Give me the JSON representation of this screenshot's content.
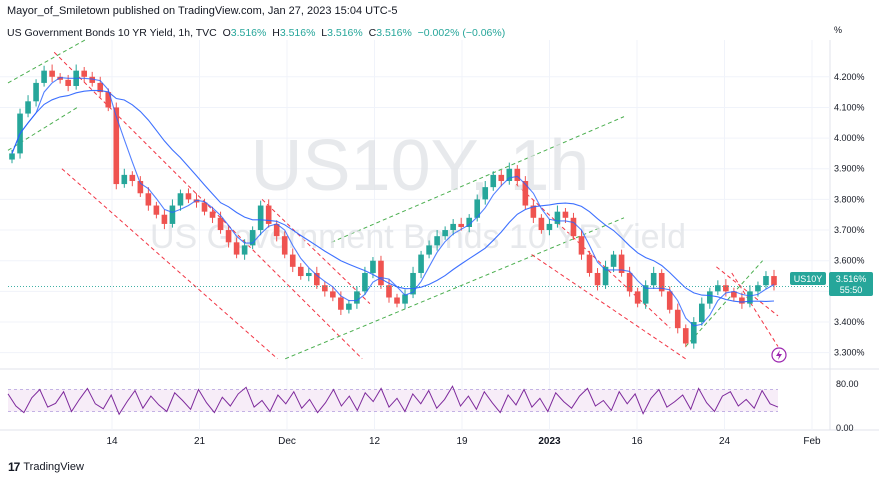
{
  "header": {
    "published": "Mayor_of_Smiletown published on TradingView.com, Jan 27, 2023 15:04 UTC-5",
    "symbol": "US Government Bonds 10 YR Yield, 1h, TVC",
    "o_label": "O",
    "o_val": "3.516%",
    "h_label": "H",
    "h_val": "3.516%",
    "l_label": "L",
    "l_val": "3.516%",
    "c_label": "C",
    "c_val": "3.516%",
    "change": "−0.002% (−0.06%)"
  },
  "watermark": {
    "big": "US10Y, 1h",
    "sub": "US Government Bonds 10 YR Yield"
  },
  "price_badge": {
    "symbol": "US10Y",
    "price": "3.516%",
    "countdown": "55:50"
  },
  "footer": {
    "brand": "TradingView",
    "logo": "17"
  },
  "colors": {
    "up": "#26a69a",
    "down": "#ef5350",
    "ma": "#2962ff",
    "rsi": "#7e2a9c",
    "green_channel": "#4caf50",
    "red_channel": "#f23645",
    "badge": "#26a69a",
    "axis_text": "#131722"
  },
  "chart_data": [
    {
      "type": "line",
      "title": "",
      "y_unit": "%",
      "y_ticks": [
        "4.200%",
        "4.100%",
        "4.000%",
        "3.900%",
        "3.800%",
        "3.700%",
        "3.600%",
        "3.500%",
        "3.400%",
        "3.300%"
      ],
      "ylim": [
        3.25,
        4.32
      ],
      "x_ticks": [
        "14",
        "21",
        "Dec",
        "12",
        "19",
        "2023",
        "16",
        "24",
        "Feb"
      ],
      "series": [
        {
          "values": [
            3.95,
            4.08,
            4.12,
            4.18,
            4.22,
            4.2,
            4.19,
            4.17,
            4.22,
            4.2,
            4.18,
            4.15,
            4.1,
            3.85,
            3.88,
            3.86,
            3.82,
            3.78,
            3.75,
            3.72,
            3.78,
            3.82,
            3.8,
            3.79,
            3.76,
            3.74,
            3.7,
            3.66,
            3.62,
            3.65,
            3.7,
            3.78,
            3.72,
            3.68,
            3.62,
            3.58,
            3.55,
            3.56,
            3.52,
            3.5,
            3.48,
            3.44,
            3.46,
            3.5,
            3.56,
            3.6,
            3.52,
            3.48,
            3.46,
            3.49,
            3.56,
            3.62,
            3.65,
            3.68,
            3.7,
            3.72,
            3.71,
            3.74,
            3.8,
            3.84,
            3.88,
            3.86,
            3.9,
            3.86,
            3.78,
            3.74,
            3.7,
            3.72,
            3.76,
            3.74,
            3.68,
            3.62,
            3.56,
            3.52,
            3.58,
            3.62,
            3.56,
            3.5,
            3.46,
            3.52,
            3.56,
            3.5,
            3.44,
            3.38,
            3.33,
            3.4,
            3.46,
            3.5,
            3.52,
            3.5,
            3.48,
            3.46,
            3.5,
            3.52,
            3.55,
            3.52
          ]
        }
      ]
    },
    {
      "type": "line",
      "title": "",
      "y_ticks": [
        "80.00",
        "0.00"
      ],
      "ylim": [
        0,
        100
      ],
      "series": [
        {
          "values": [
            62,
            40,
            28,
            55,
            70,
            38,
            45,
            66,
            30,
            52,
            72,
            44,
            35,
            60,
            25,
            48,
            68,
            36,
            58,
            42,
            30,
            64,
            50,
            34,
            70,
            46,
            28,
            56,
            40,
            62,
            74,
            38,
            50,
            30,
            60,
            44,
            66,
            36,
            52,
            28,
            46,
            70,
            40,
            58,
            32,
            64,
            48,
            72,
            38,
            54,
            30,
            62,
            44,
            68,
            36,
            52,
            76,
            40,
            58,
            34,
            66,
            46,
            28,
            60,
            42,
            70,
            38,
            54,
            30,
            64,
            48,
            36,
            58,
            72,
            40,
            50,
            32,
            66,
            44,
            62,
            26,
            54,
            70,
            38,
            48,
            60,
            34,
            72,
            46,
            30,
            58,
            66,
            40,
            52,
            36,
            68,
            44,
            38
          ]
        }
      ]
    }
  ]
}
